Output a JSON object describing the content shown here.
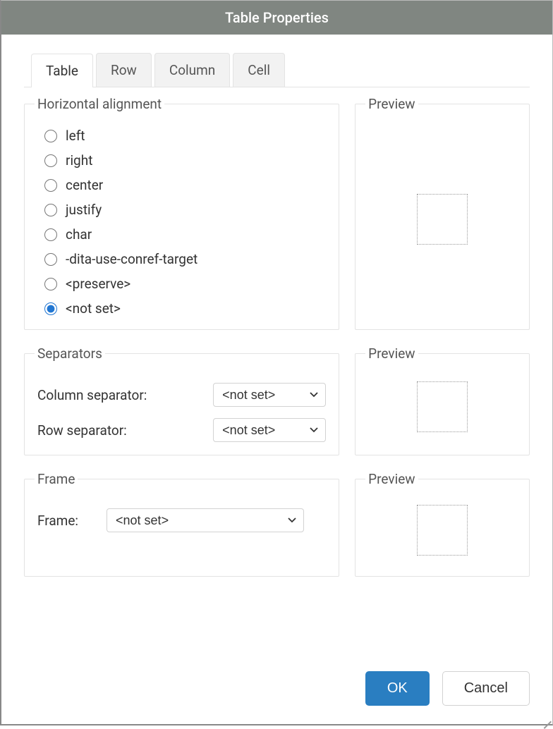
{
  "title": "Table Properties",
  "tabs": [
    "Table",
    "Row",
    "Column",
    "Cell"
  ],
  "active_tab": 0,
  "halign": {
    "legend": "Horizontal alignment",
    "options": [
      "left",
      "right",
      "center",
      "justify",
      "char",
      "-dita-use-conref-target",
      "<preserve>",
      "<not set>"
    ],
    "selected_index": 7
  },
  "preview_label": "Preview",
  "separators": {
    "legend": "Separators",
    "col_label": "Column separator:",
    "row_label": "Row separator:",
    "col_value": "<not set>",
    "row_value": "<not set>"
  },
  "frame": {
    "legend": "Frame",
    "label": "Frame:",
    "value": "<not set>"
  },
  "buttons": {
    "ok": "OK",
    "cancel": "Cancel"
  }
}
